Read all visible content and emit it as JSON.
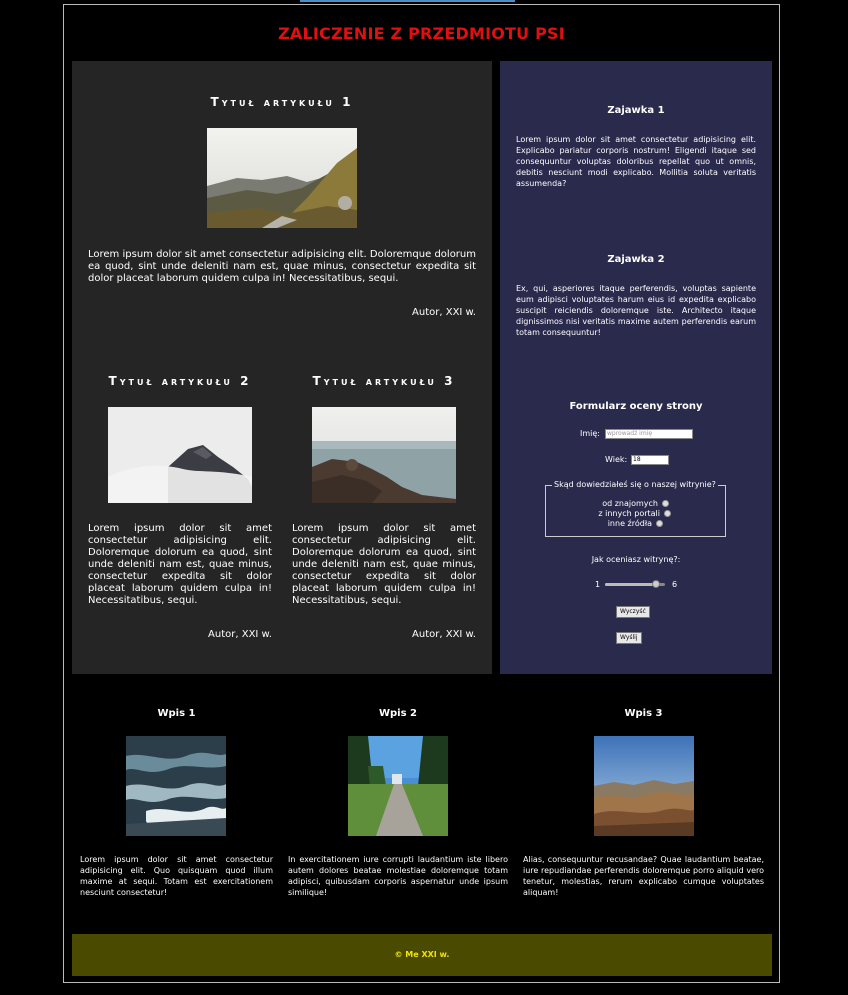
{
  "page": {
    "title": "ZALICZENIE Z PRZEDMIOTU PSI"
  },
  "articles": [
    {
      "title": "Tytuł artykułu 1",
      "text": "Lorem ipsum dolor sit amet consectetur adipisicing elit. Doloremque dolorum ea quod, sint unde deleniti nam est, quae minus, consectetur expedita sit dolor placeat laborum quidem culpa in! Necessitatibus, sequi.",
      "author": "Autor, XXI w."
    },
    {
      "title": "Tytuł artykułu 2",
      "text": "Lorem ipsum dolor sit amet consectetur adipisicing elit. Doloremque dolorum ea quod, sint unde deleniti nam est, quae minus, consectetur expedita sit dolor placeat laborum quidem culpa in! Necessitatibus, sequi.",
      "author": "Autor, XXI w."
    },
    {
      "title": "Tytuł artykułu 3",
      "text": "Lorem ipsum dolor sit amet consectetur adipisicing elit. Doloremque dolorum ea quod, sint unde deleniti nam est, quae minus, consectetur expedita sit dolor placeat laborum quidem culpa in! Necessitatibus, sequi.",
      "author": "Autor, XXI w."
    }
  ],
  "teasers": [
    {
      "title": "Zajawka 1",
      "text": "Lorem ipsum dolor sit amet consectetur adipisicing elit. Explicabo pariatur corporis nostrum! Eligendi itaque sed consequuntur voluptas doloribus repellat quo ut omnis, debitis nesciunt modi explicabo. Mollitia soluta veritatis assumenda?"
    },
    {
      "title": "Zajawka 2",
      "text": "Ex, qui, asperiores itaque perferendis, voluptas sapiente eum adipisci voluptates harum eius id expedita explicabo suscipit reiciendis doloremque iste. Architecto itaque dignissimos nisi veritatis maxime autem perferendis earum totam consequuntur!"
    }
  ],
  "form": {
    "title": "Formularz oceny strony",
    "name_label": "Imię:",
    "name_placeholder": "wprowadź imię",
    "age_label": "Wiek:",
    "age_value": "18",
    "source_legend": "Skąd dowiedziałeś się o naszej witrynie?",
    "source_options": [
      "od znajomych",
      "z innych portali",
      "inne źródła"
    ],
    "rating_label": "Jak oceniasz witrynę?:",
    "rating_min": "1",
    "rating_max": "6",
    "rating_value_fraction": 0.85,
    "clear_button": "Wyczyść",
    "submit_button": "Wyślij"
  },
  "posts": [
    {
      "title": "Wpis 1",
      "text": "Lorem ipsum dolor sit amet consectetur adipisicing elit. Quo quisquam quod illum maxime at sequi. Totam est exercitationem nesciunt consectetur!"
    },
    {
      "title": "Wpis 2",
      "text": "In exercitationem iure corrupti laudantium iste libero autem dolores beatae molestiae doloremque totam adipisci, quibusdam corporis aspernatur unde ipsum similique!"
    },
    {
      "title": "Wpis 3",
      "text": "Alias, consequuntur recusandae? Quae laudantium beatae, iure repudiandae perferendis doloremque porro aliquid vero tenetur, molestias, rerum explicabo cumque voluptates aliquam!"
    }
  ],
  "footer": {
    "text": "© Me XXI w."
  }
}
